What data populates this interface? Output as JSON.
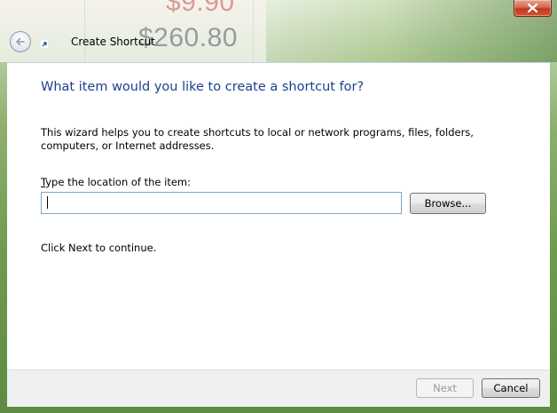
{
  "window": {
    "title": "Create Shortcut",
    "background_price_top": "$9.90",
    "background_price_bottom": "$260.80"
  },
  "titlebar": {
    "close_icon": "close-x-icon",
    "back_icon": "back-arrow-icon"
  },
  "wizard": {
    "heading": "What item would you like to create a shortcut for?",
    "description": "This wizard helps you to create shortcuts to local or network programs, files, folders, computers, or Internet addresses.",
    "location_label_mnemonic": "T",
    "location_label_rest": "ype the location of the item:",
    "location_value": "",
    "browse_label": "Browse...",
    "continue_text": "Click Next to continue."
  },
  "footer": {
    "next_label": "Next",
    "cancel_label": "Cancel"
  },
  "colors": {
    "heading": "#1d3f8f",
    "close_button": "#c0391e",
    "input_border": "#7aa7c9"
  }
}
